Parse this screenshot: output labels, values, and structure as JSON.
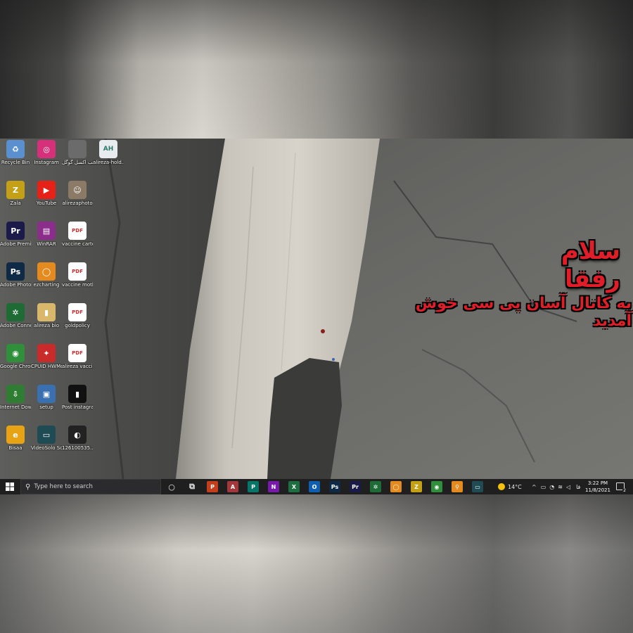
{
  "desktop": {
    "icons": [
      {
        "label": "Recycle Bin",
        "glyph": "♻",
        "color": "#5a8fd0"
      },
      {
        "label": "Instagram",
        "glyph": "◎",
        "color": "#d6307a"
      },
      {
        "label": "آموزش نصب اکسل گوگل",
        "glyph": "",
        "color": "#6b6b6b"
      },
      {
        "label": "alireza-hold...",
        "glyph": "AH",
        "color": "#e9ecef"
      },
      {
        "label": "Zala",
        "glyph": "Z",
        "color": "#c4a017"
      },
      {
        "label": "YouTube",
        "glyph": "▶",
        "color": "#e62117"
      },
      {
        "label": "alirezaphoto",
        "glyph": "☺",
        "color": "#8a7a66"
      },
      {
        "label": "Adobe Premiere P...",
        "glyph": "Pr",
        "color": "#1b1b4b"
      },
      {
        "label": "WinRAR",
        "glyph": "▤",
        "color": "#8b2d8a"
      },
      {
        "label": "vaccine carter",
        "glyph": "PDF",
        "color": "#ffffff"
      },
      {
        "label": "Adobe Photosh...",
        "glyph": "Ps",
        "color": "#0e2a47"
      },
      {
        "label": "ezcharting",
        "glyph": "◯",
        "color": "#e58a1f"
      },
      {
        "label": "vaccine mother",
        "glyph": "PDF",
        "color": "#ffffff"
      },
      {
        "label": "Adobe Connect",
        "glyph": "✲",
        "color": "#1f6b35"
      },
      {
        "label": "alireza bio",
        "glyph": "▮",
        "color": "#d9b86b"
      },
      {
        "label": "goldpolicy",
        "glyph": "PDF",
        "color": "#ffffff"
      },
      {
        "label": "Google Chrome",
        "glyph": "◉",
        "color": "#2f8f3a"
      },
      {
        "label": "CPUID HWMonitor",
        "glyph": "✦",
        "color": "#c92a2a"
      },
      {
        "label": "alireza vaccine",
        "glyph": "PDF",
        "color": "#ffffff"
      },
      {
        "label": "Internet Downlo...",
        "glyph": "⇩",
        "color": "#2e7d32"
      },
      {
        "label": "setup",
        "glyph": "▣",
        "color": "#3a6fb0"
      },
      {
        "label": "Post instagram",
        "glyph": "▮",
        "color": "#111111"
      },
      {
        "label": "Bisaa",
        "glyph": "e",
        "color": "#e8a314"
      },
      {
        "label": "VideoSolo Screen R...",
        "glyph": "▭",
        "color": "#1f4b55"
      },
      {
        "label": "126100535...",
        "glyph": "◐",
        "color": "#222222"
      }
    ]
  },
  "overlay": {
    "line1": "سلام رفقا",
    "line2": "به کانال آسان پی سی خوش آمدید"
  },
  "taskbar": {
    "search_placeholder": "Type here to search",
    "apps": [
      {
        "name": "cortana",
        "glyph": "○",
        "color": "transparent"
      },
      {
        "name": "task-view",
        "glyph": "⧉",
        "color": "transparent"
      },
      {
        "name": "powerpoint",
        "glyph": "P",
        "color": "#c43e1c"
      },
      {
        "name": "access",
        "glyph": "A",
        "color": "#a4373a"
      },
      {
        "name": "publisher",
        "glyph": "P",
        "color": "#077568"
      },
      {
        "name": "onenote",
        "glyph": "N",
        "color": "#7719aa"
      },
      {
        "name": "excel",
        "glyph": "X",
        "color": "#1d6f42"
      },
      {
        "name": "outlook",
        "glyph": "O",
        "color": "#0f5fb0"
      },
      {
        "name": "photoshop",
        "glyph": "Ps",
        "color": "#0e2a47"
      },
      {
        "name": "premiere",
        "glyph": "Pr",
        "color": "#1b1b4b"
      },
      {
        "name": "adobe-connect",
        "glyph": "✲",
        "color": "#1f6b35"
      },
      {
        "name": "ezcharting",
        "glyph": "◯",
        "color": "#e58a1f"
      },
      {
        "name": "zala",
        "glyph": "Z",
        "color": "#c4a017"
      },
      {
        "name": "chrome",
        "glyph": "◉",
        "color": "#2f8f3a"
      },
      {
        "name": "search-tool",
        "glyph": "⚲",
        "color": "#e58a1f"
      },
      {
        "name": "videosolo",
        "glyph": "▭",
        "color": "#1f4b55"
      }
    ],
    "weather": "14°C",
    "language": "فا",
    "time": "3:22 PM",
    "date": "11/8/2021"
  }
}
